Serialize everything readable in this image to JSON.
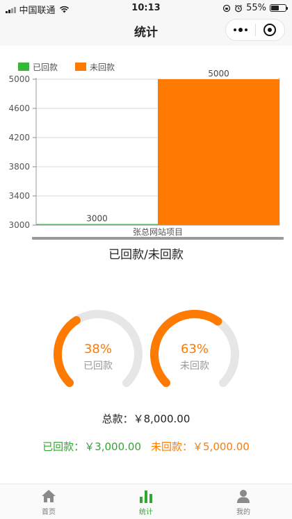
{
  "status_bar": {
    "carrier": "中国联通",
    "time": "10:13",
    "battery": "55%",
    "battery_level": 0.55
  },
  "nav": {
    "title": "统计"
  },
  "chart_data": {
    "type": "bar",
    "categories": [
      "张总网站项目"
    ],
    "series": [
      {
        "name": "已回款",
        "values": [
          3000
        ],
        "color": "#35b835"
      },
      {
        "name": "未回款",
        "values": [
          5000
        ],
        "color": "#ff7a00"
      }
    ],
    "ylim": [
      3000,
      5000
    ],
    "yticks": [
      3000,
      3400,
      3800,
      4200,
      4600,
      5000
    ],
    "grid": true,
    "legend": "top-left",
    "caption": "已回款/未回款"
  },
  "gauges": [
    {
      "percent_text": "38%",
      "label": "已回款",
      "fraction": 0.38,
      "color": "#ff7a00"
    },
    {
      "percent_text": "63%",
      "label": "未回款",
      "fraction": 0.63,
      "color": "#ff7a00"
    }
  ],
  "summary": {
    "total_label": "总款：",
    "total_value": "￥8,000.00",
    "paid_label": "已回款：",
    "paid_value": "￥3,000.00",
    "unpaid_label": "未回款：",
    "unpaid_value": "￥5,000.00"
  },
  "tabs": [
    {
      "label": "首页",
      "icon": "home-icon",
      "active": false
    },
    {
      "label": "统计",
      "icon": "bar-chart-icon",
      "active": true
    },
    {
      "label": "我的",
      "icon": "user-icon",
      "active": false
    }
  ],
  "colors": {
    "accent_green": "#2ea82e",
    "accent_orange": "#ff7a00"
  }
}
